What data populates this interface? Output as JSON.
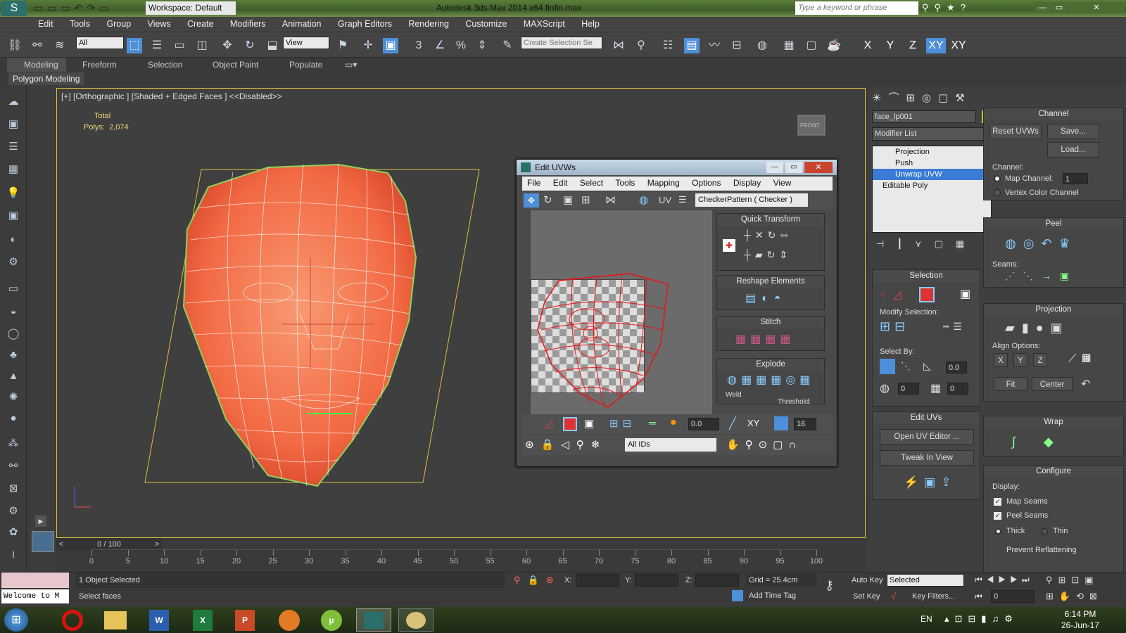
{
  "app": {
    "title": "Autodesk 3ds Max  2014 x64    finfin.max",
    "workspace": "Workspace: Default",
    "search_placeholder": "Type a keyword or phrase"
  },
  "menu": [
    "Edit",
    "Tools",
    "Group",
    "Views",
    "Create",
    "Modifiers",
    "Animation",
    "Graph Editors",
    "Rendering",
    "Customize",
    "MAXScript",
    "Help"
  ],
  "toolbar": {
    "selection_filter": "All",
    "ref_coord": "View",
    "create_selection_set": "Create Selection Se",
    "axes": [
      "X",
      "Y",
      "Z",
      "XY",
      "XY"
    ],
    "snap_numbers": [
      "3",
      "%"
    ]
  },
  "ribbon": {
    "tabs": [
      "Modeling",
      "Freeform",
      "Selection",
      "Object Paint",
      "Populate"
    ],
    "sub": "Polygon Modeling"
  },
  "viewport": {
    "label": "[+] [Orthographic ] [Shaded + Edged Faces ]  <<Disabled>>",
    "stats_title": "Total",
    "stats_label": "Polys:",
    "stats_value": "2,074",
    "viewcube": "FRONT"
  },
  "uvw": {
    "title": "Edit UVWs",
    "menu": [
      "File",
      "Edit",
      "Select",
      "Tools",
      "Mapping",
      "Options",
      "Display",
      "View"
    ],
    "checker": "CheckerPattern  ( Checker )",
    "uv_label": "UV",
    "sections": [
      "Quick Transform",
      "Reshape Elements",
      "Stitch",
      "Explode"
    ],
    "weld": "Weld",
    "threshold": "Threshold:",
    "value1": "0.0",
    "xy": "XY",
    "value2": "16",
    "ids": "All IDs"
  },
  "command_panel": {
    "object_name": "face_lp001",
    "object_color": "#b5cc22",
    "modifier_list": "Modifier List",
    "stack": [
      "Projection",
      "Push",
      "Unwrap UVW",
      "Editable Poly"
    ],
    "selection_title": "Selection",
    "modify_selection": "Modify Selection:",
    "select_by": "Select By:",
    "select_by_values": [
      "0.0",
      "0",
      "0"
    ],
    "edit_uvs_title": "Edit UVs",
    "open_uv_editor": "Open UV Editor ...",
    "tweak_in_view": "Tweak In View"
  },
  "channel_panel": {
    "channel_title": "Channel",
    "reset_uvws": "Reset UVWs",
    "save": "Save...",
    "load": "Load...",
    "channel_label": "Channel:",
    "map_channel": "Map Channel:",
    "map_channel_value": "1",
    "vertex_color_channel": "Vertex Color Channel",
    "peel_title": "Peel",
    "seams_label": "Seams:",
    "projection_title": "Projection",
    "align_options": "Align Options:",
    "align_axes": [
      "X",
      "Y",
      "Z"
    ],
    "fit": "Fit",
    "center": "Center",
    "wrap_title": "Wrap",
    "configure_title": "Configure",
    "display_label": "Display:",
    "map_seams": "Map Seams",
    "peel_seams": "Peel Seams",
    "thick": "Thick",
    "thin": "Thin",
    "prevent": "Prevent Reflattening"
  },
  "timeline": {
    "frame": "0 / 100",
    "ticks": [
      "0",
      "5",
      "10",
      "15",
      "20",
      "25",
      "30",
      "35",
      "40",
      "45",
      "50",
      "55",
      "60",
      "65",
      "70",
      "75",
      "80",
      "85",
      "90",
      "95",
      "100"
    ]
  },
  "status": {
    "selected": "1 Object Selected",
    "prompt": "Select faces",
    "welcome": "Welcome to M",
    "x_label": "X:",
    "y_label": "Y:",
    "z_label": "Z:",
    "grid": "Grid = 25.4cm",
    "add_time_tag": "Add Time Tag",
    "auto_key": "Auto Key",
    "set_key": "Set Key",
    "selected_dropdown": "Selected",
    "key_filters": "Key Filters...",
    "frame_field": "0"
  },
  "taskbar": {
    "lang": "EN",
    "time": "6:14 PM",
    "date": "26-Jun-17"
  }
}
